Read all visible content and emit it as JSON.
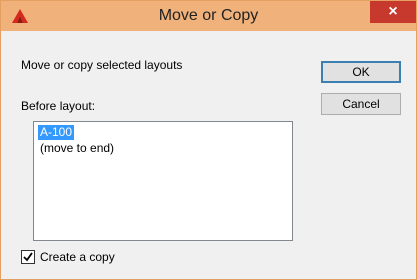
{
  "window": {
    "title": "Move or Copy",
    "close_glyph": "×",
    "app_icon": "autocad-icon"
  },
  "dialog": {
    "description": "Move or copy selected layouts",
    "ok_label": "OK",
    "cancel_label": "Cancel",
    "list_label": "Before layout:",
    "list_items": [
      {
        "label": "A-100",
        "selected": true
      },
      {
        "label": "(move to end)",
        "selected": false
      }
    ],
    "copy_checkbox": {
      "label": "Create a copy",
      "checked": true
    }
  },
  "colors": {
    "titlebar": "#f0b27a",
    "close_button": "#c7392c",
    "selection": "#3399ff",
    "icon": "#d42a1e"
  }
}
